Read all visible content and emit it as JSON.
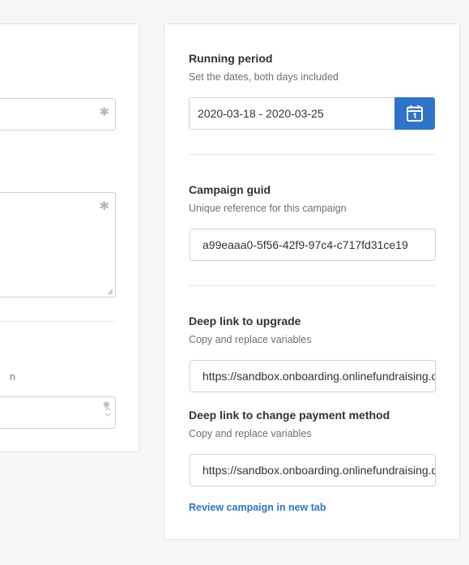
{
  "left_panel": {
    "partial_text": "n"
  },
  "running_period": {
    "label": "Running period",
    "help": "Set the dates, both days included",
    "value": "2020-03-18 - 2020-03-25"
  },
  "campaign_guid": {
    "label": "Campaign guid",
    "help": "Unique reference for this campaign",
    "value": "a99eaaa0-5f56-42f9-97c4-c717fd31ce19"
  },
  "deep_link_upgrade": {
    "label": "Deep link to upgrade",
    "help": "Copy and replace variables",
    "value": "https://sandbox.onboarding.onlinefundraising.dk/campaign/upgrade"
  },
  "deep_link_payment": {
    "label": "Deep link to change payment method",
    "help": "Copy and replace variables",
    "value": "https://sandbox.onboarding.onlinefundraising.dk/campaign/payment"
  },
  "review_link": "Review campaign in new tab",
  "colors": {
    "accent": "#2f74c8",
    "background": "#f6f6f6",
    "border": "#cfd3d6"
  }
}
